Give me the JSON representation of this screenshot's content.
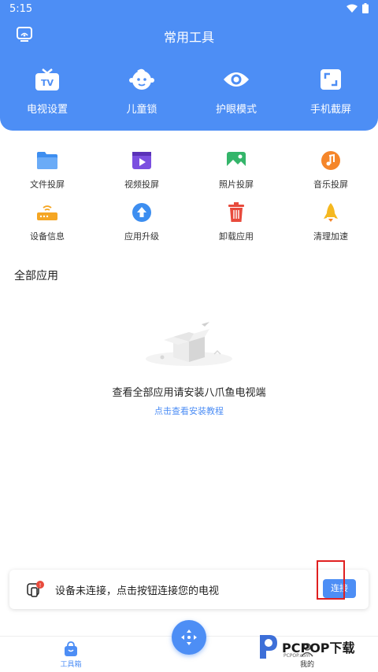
{
  "status_bar": {
    "time": "5:15"
  },
  "header": {
    "title": "常用工具",
    "tools": [
      {
        "label": "电视设置",
        "icon": "tv-icon"
      },
      {
        "label": "儿童锁",
        "icon": "child-face-icon"
      },
      {
        "label": "护眼模式",
        "icon": "eye-icon"
      },
      {
        "label": "手机截屏",
        "icon": "screenshot-icon"
      }
    ]
  },
  "tools": [
    {
      "label": "文件投屏",
      "icon": "folder-icon",
      "color": "#3d8ef0"
    },
    {
      "label": "视频投屏",
      "icon": "video-icon",
      "color": "#7b4fe0"
    },
    {
      "label": "照片投屏",
      "icon": "photo-icon",
      "color": "#34b56a"
    },
    {
      "label": "音乐投屏",
      "icon": "music-icon",
      "color": "#f5862a"
    },
    {
      "label": "设备信息",
      "icon": "router-icon",
      "color": "#f5a623"
    },
    {
      "label": "应用升级",
      "icon": "upgrade-icon",
      "color": "#3d8ef0"
    },
    {
      "label": "卸载应用",
      "icon": "trash-icon",
      "color": "#e84a3c"
    },
    {
      "label": "清理加速",
      "icon": "rocket-icon",
      "color": "#f5b820"
    }
  ],
  "all_apps": {
    "title": "全部应用",
    "empty_text": "查看全部应用请安装八爪鱼电视端",
    "empty_link": "点击查看安装教程"
  },
  "connection": {
    "text": "设备未连接，点击按钮连接您的电视",
    "button": "连接"
  },
  "tabbar": {
    "tabs": [
      {
        "label": "工具箱",
        "icon": "bag-icon",
        "active": true
      },
      {
        "label": "我的",
        "icon": "user-icon",
        "active": false
      }
    ]
  },
  "watermark": {
    "text": "PCPOP下载",
    "sub": "PCPOP.com"
  },
  "colors": {
    "brand": "#4d8ef5",
    "alert": "#e84a3c"
  }
}
